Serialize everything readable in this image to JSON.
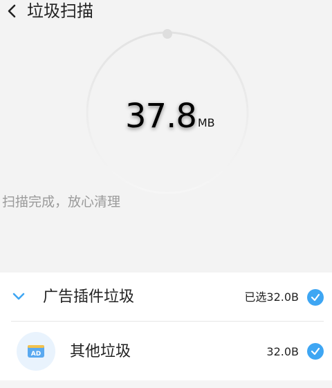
{
  "header": {
    "back_icon": "chevron-left-icon",
    "title": "垃圾扫描"
  },
  "scan": {
    "size_value": "37.8",
    "size_unit": "MB",
    "status": "扫描完成，放心清理"
  },
  "category": {
    "label": "广告插件垃圾",
    "selected_text": "已选32.0B",
    "expanded": true,
    "checked": true
  },
  "items": [
    {
      "label": "其他垃圾",
      "size": "32.0B",
      "icon": "ad-icon",
      "icon_text": "AD",
      "checked": true
    }
  ],
  "colors": {
    "accent": "#3ea6f3",
    "background": "#f3f3f3",
    "panel": "#ffffff",
    "status_text": "#9a9a9a"
  }
}
